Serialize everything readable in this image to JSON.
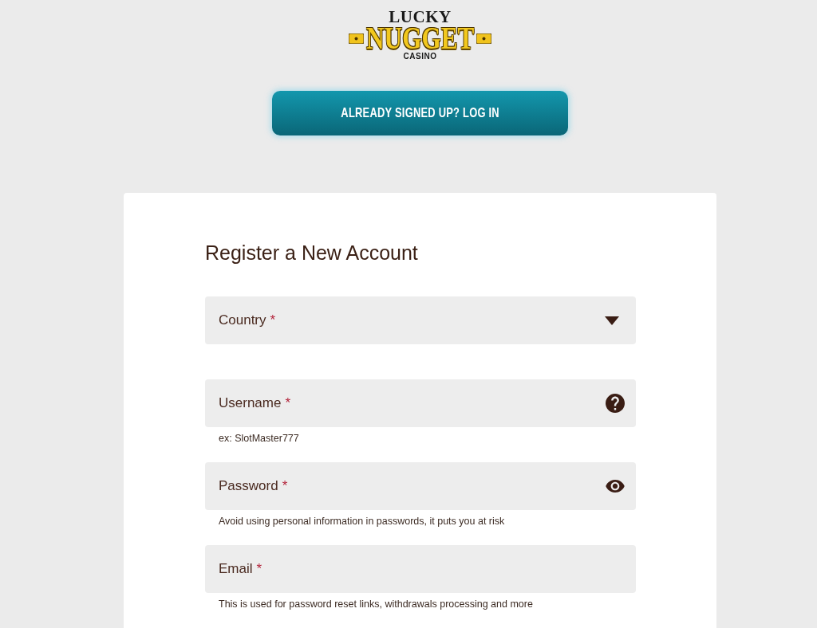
{
  "logo": {
    "top_text": "LUCKY",
    "main_text": "NUGGET",
    "bottom_text": "CASINO"
  },
  "login_button": {
    "label": "ALREADY SIGNED UP? LOG IN"
  },
  "form": {
    "title": "Register a New Account",
    "fields": [
      {
        "kind": "select",
        "label": "Country",
        "required_mark": "*"
      },
      {
        "kind": "help",
        "label": "Username",
        "required_mark": "*",
        "hint": "ex: SlotMaster777"
      },
      {
        "kind": "password",
        "label": "Password",
        "required_mark": "*",
        "hint": "Avoid using personal information in passwords, it puts you at risk"
      },
      {
        "kind": "text",
        "label": "Email",
        "required_mark": "*",
        "hint": "This is used for password reset links, withdrawals processing and more"
      }
    ]
  }
}
